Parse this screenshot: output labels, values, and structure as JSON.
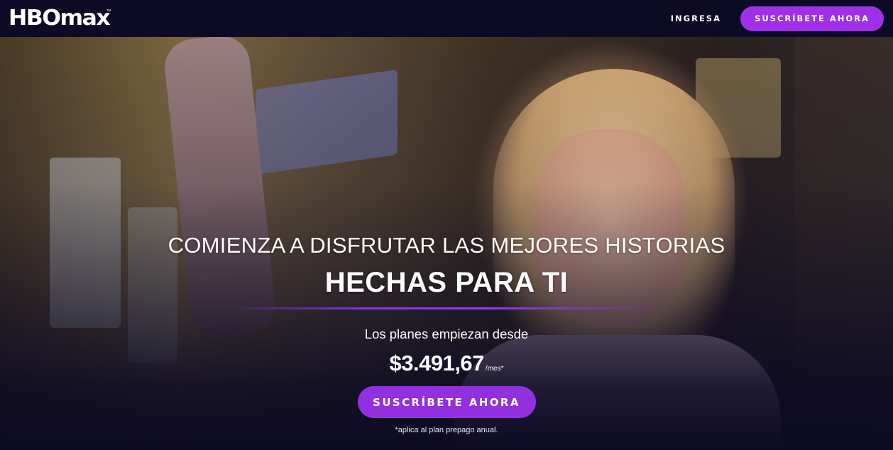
{
  "header": {
    "logo_text": "HBOmax",
    "logo_tm": "™",
    "signin_label": "INGRESA",
    "subscribe_label": "SUSCRÍBETE AHORA"
  },
  "hero": {
    "headline": "COMIENZA A DISFRUTAR LAS MEJORES HISTORIAS",
    "subheadline": "HECHAS PARA TI",
    "plans_text": "Los planes empiezan desde",
    "price": "$3.491,67",
    "price_period": "/mes*",
    "cta_label": "SUSCRÍBETE AHORA",
    "footnote": "*aplica al plan prepago anual."
  },
  "colors": {
    "header_bg": "#0c0a24",
    "accent_purple": "#9f2fe8",
    "cta_purple": "#9230e0"
  }
}
